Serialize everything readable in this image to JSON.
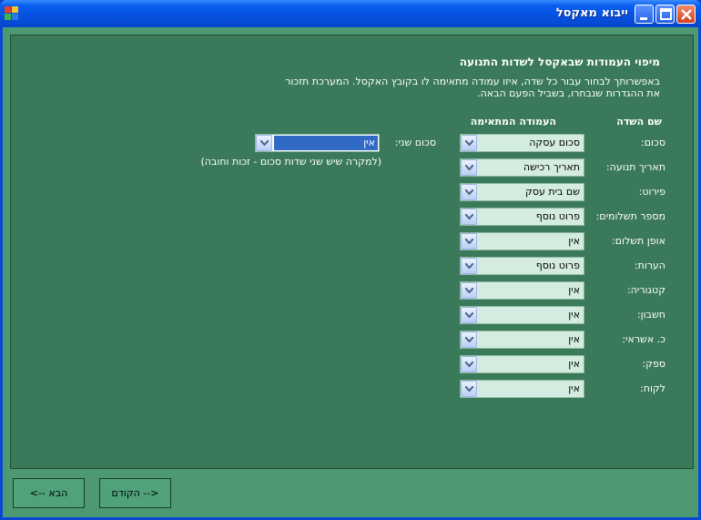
{
  "window": {
    "title": "ייבוא מאקסל"
  },
  "page": {
    "heading": "מיפוי העמודות שבאקסל לשדות התנועה",
    "description": "באפשרותך לבחור עבור כל שדה, איזו עמודה מתאימה לו בקובץ האקסל. המערכת תזכור את ההגדרות שנבחרו, בשביל הפעם הבאה.",
    "col_field_name": "שם השדה",
    "col_matching_column": "העמודה המתאימה"
  },
  "rows": [
    {
      "label": "סכום:",
      "value": "סכום עסקה"
    },
    {
      "label": "תאריך תנועה:",
      "value": "תאריך רכישה"
    },
    {
      "label": "פירוט:",
      "value": "שם בית עסק"
    },
    {
      "label": "מספר תשלומים:",
      "value": "פרוט נוסף"
    },
    {
      "label": "אופן תשלום:",
      "value": "אין"
    },
    {
      "label": "הערות:",
      "value": "פרוט נוסף"
    },
    {
      "label": "קטגוריה:",
      "value": "אין"
    },
    {
      "label": "חשבון:",
      "value": "אין"
    },
    {
      "label": "כ. אשראי:",
      "value": "אין"
    },
    {
      "label": "ספק:",
      "value": "אין"
    },
    {
      "label": "לקוח:",
      "value": "אין"
    }
  ],
  "second_amount": {
    "label": "סכום שני:",
    "value": "אין",
    "note": "(למקרה שיש שני שדות סכום - זכות וחובה)"
  },
  "buttons": {
    "next": "הבא  -->",
    "previous": "<--  הקודם"
  },
  "colors": {
    "client_bg": "#4d9a72",
    "panel_bg": "#3a7a5a",
    "combo_bg": "#d4ecdf",
    "selection": "#316ac5"
  }
}
